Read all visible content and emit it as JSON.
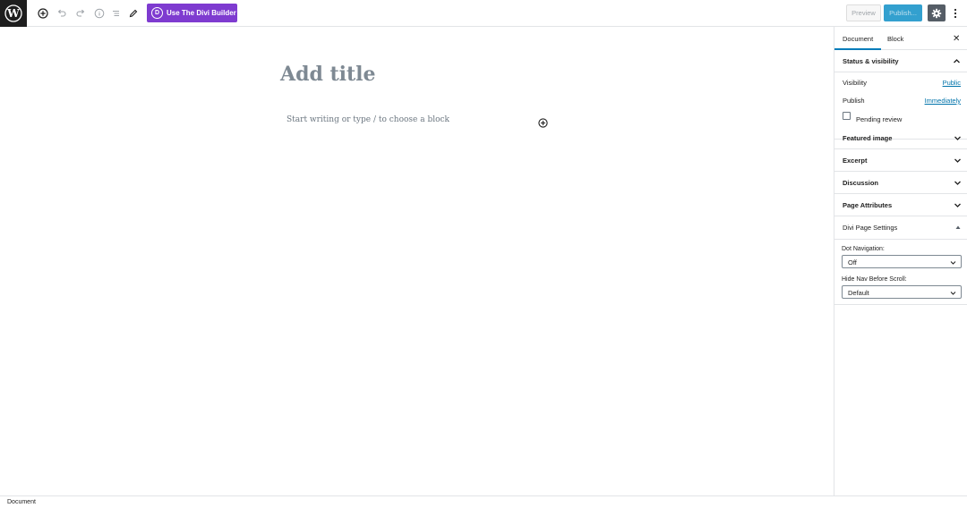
{
  "toolbar": {
    "divi_button_label": "Use The Divi Builder",
    "divi_badge": "D",
    "preview_label": "Preview",
    "publish_label": "Publish..."
  },
  "editor": {
    "title_placeholder": "Add title",
    "body_placeholder": "Start writing or type / to choose a block"
  },
  "sidebar": {
    "tabs": [
      {
        "label": "Document",
        "active": true
      },
      {
        "label": "Block",
        "active": false
      }
    ],
    "close_glyph": "✕",
    "status_visibility": {
      "heading": "Status & visibility",
      "visibility_label": "Visibility",
      "visibility_value": "Public",
      "publish_label": "Publish",
      "publish_value": "Immediately",
      "pending_review_label": "Pending review",
      "pending_review_checked": false
    },
    "panels": [
      {
        "label": "Featured image"
      },
      {
        "label": "Excerpt"
      },
      {
        "label": "Discussion"
      },
      {
        "label": "Page Attributes"
      },
      {
        "label": "Divi Page Settings"
      }
    ],
    "divi_settings": {
      "dot_navigation_label": "Dot Navigation:",
      "dot_navigation_value": "Off",
      "hide_nav_label": "Hide Nav Before Scroll:",
      "hide_nav_value": "Default"
    }
  },
  "footer": {
    "breadcrumb": "Document"
  },
  "colors": {
    "divi_purple": "#7e3bd0",
    "publish_blue": "#33a0cf",
    "link_blue": "#0073aa",
    "settings_dark": "#555d66",
    "wp_logo_bg": "#1e1e1e"
  },
  "icons": [
    "wordpress-logo-icon",
    "add-block-icon",
    "undo-icon",
    "redo-icon",
    "info-icon",
    "list-view-icon",
    "edit-tools-icon",
    "gear-icon",
    "more-options-icon",
    "close-icon",
    "chevron-up-icon",
    "chevron-down-icon",
    "add-block-inline-icon"
  ]
}
